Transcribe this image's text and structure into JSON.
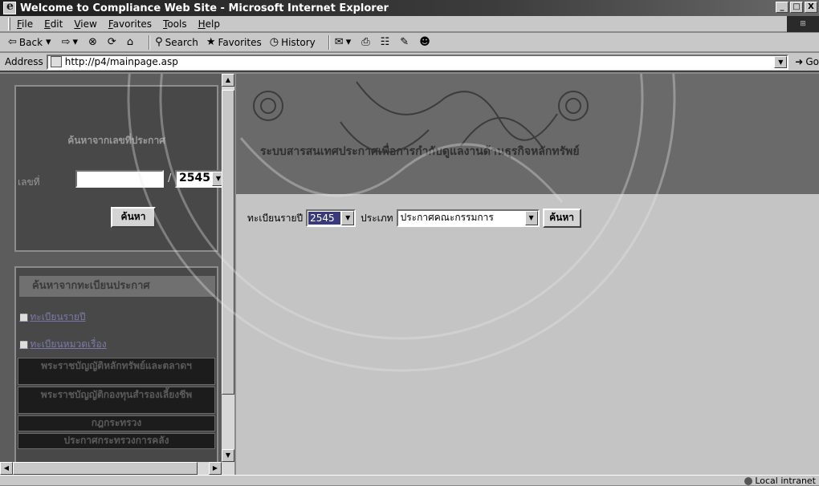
{
  "window": {
    "title": "Welcome to Compliance Web Site - Microsoft Internet Explorer",
    "minimize": "_",
    "maximize": "□",
    "close": "X"
  },
  "menu": [
    "File",
    "Edit",
    "View",
    "Favorites",
    "Tools",
    "Help"
  ],
  "toolbar": {
    "back": "Back",
    "search": "Search",
    "favorites": "Favorites",
    "history": "History"
  },
  "address": {
    "label": "Address",
    "url": "http://p4/mainpage.asp",
    "go": "Go"
  },
  "left": {
    "search_title": "ค้นหาจากเลขที่ประกาศ",
    "number_label": "เลขที่",
    "number_value": "",
    "slash": "/",
    "year": "2545",
    "search_button": "ค้นหา",
    "register_title": "ค้นหาจากทะเบียนประกาศ",
    "links": [
      "ทะเบียนรายปี",
      "ทะเบียนหมวดเรื่อง"
    ],
    "cells": [
      "พระราชบัญญัติหลักทรัพย์และตลาดฯ",
      "พระราชบัญญัติกองทุนสำรองเลี้ยงชีพ",
      "กฎกระทรวง",
      "ประกาศกระทรวงการคลัง"
    ]
  },
  "right": {
    "banner_title": "ระบบสารสนเทศประกาศเพื่อการกำกับดูแลงานด้านธุรกิจหลักทรัพย์",
    "year_label": "ทะเบียนรายปี",
    "year_value": "2545",
    "type_label": "ประเภท",
    "type_value": "ประกาศคณะกรรมการ",
    "search_button": "ค้นหา"
  },
  "status": {
    "zone": "Local intranet"
  }
}
